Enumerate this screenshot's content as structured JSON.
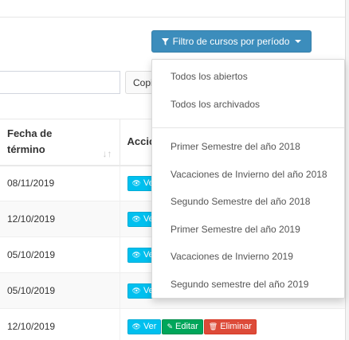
{
  "toolbar": {
    "filter_button_label": "Filtro de cursos por período",
    "copy_button_label": "Copiar"
  },
  "table": {
    "columns": [
      "Fecha de término",
      "Acciones"
    ],
    "rows": [
      {
        "end_date": "08/11/2019"
      },
      {
        "end_date": "12/10/2019"
      },
      {
        "end_date": "05/10/2019"
      },
      {
        "end_date": "05/10/2019"
      },
      {
        "end_date": "12/10/2019"
      }
    ],
    "actions": {
      "view_label": "Ver",
      "edit_label": "Editar",
      "delete_label": "Eliminar"
    }
  },
  "dropdown": {
    "group_general": [
      "Todos los abiertos",
      "Todos los archivados"
    ],
    "group_periods": [
      "Primer Semestre del año 2018",
      "Vacaciones de Invierno del año 2018",
      "Segundo Semestre del año 2018",
      "Primer Semestre del año 2019",
      "Vacaciones de Invierno 2019",
      "Segundo semestre del año 2019"
    ]
  },
  "colors": {
    "primary": "#3c8dbc",
    "info": "#00c0ef",
    "success": "#00a65a",
    "danger": "#dd4b39"
  },
  "icons": {
    "filter": "filter-icon",
    "sort": "sort-icon",
    "view": "eye-icon",
    "edit": "edit-icon",
    "delete": "trash-icon"
  }
}
